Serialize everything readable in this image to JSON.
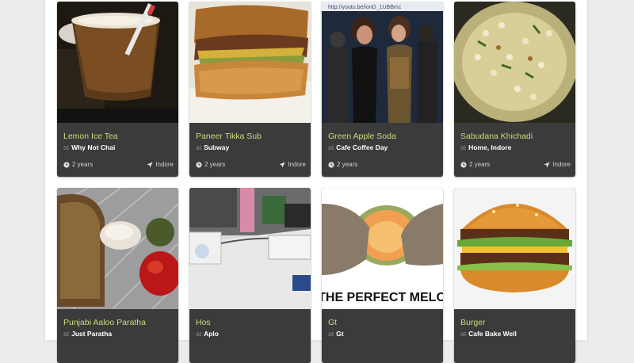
{
  "cards": [
    {
      "title": "Lemon Ice Tea",
      "at": "at",
      "place": "Why Not Chai",
      "time": "2 years",
      "city": "Indore"
    },
    {
      "title": "Paneer Tikka Sub",
      "at": "at",
      "place": "Subway",
      "time": "2 years",
      "city": "Indore"
    },
    {
      "title": "Green Apple Soda",
      "at": "at",
      "place": "Cafe Coffee Day",
      "time": "2 years",
      "city": ""
    },
    {
      "title": "Sabudana Khichadi",
      "at": "at",
      "place": "Home, Indore",
      "time": "2 years",
      "city": "Indore"
    },
    {
      "title": "Punjabi Aaloo Paratha",
      "at": "at",
      "place": "Just Paratha"
    },
    {
      "title": "Hos",
      "at": "at",
      "place": "Aplo"
    },
    {
      "title": "Gt",
      "at": "at",
      "place": "Gt"
    },
    {
      "title": "Burger",
      "at": "at",
      "place": "Cafe Bake Well"
    }
  ],
  "photos": {
    "soda_url": "http://youtu.be/ionD_1UBBmc",
    "melon_caption": "THE PERFECT MELO"
  },
  "icons": {
    "time": "clock-icon",
    "location": "location-arrow-icon"
  },
  "colors": {
    "card_bg": "#3b3b3b",
    "title": "#c6de7a",
    "page_bg": "#ececec"
  }
}
